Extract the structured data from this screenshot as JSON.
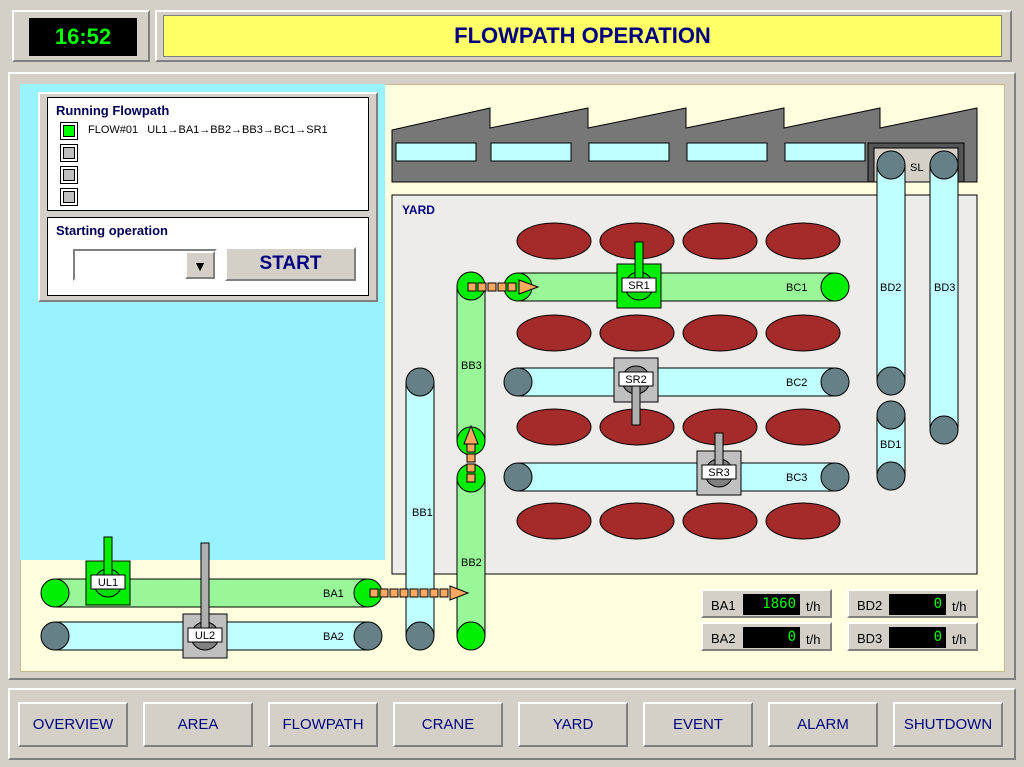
{
  "header": {
    "clock": "16:52",
    "title": "FLOWPATH OPERATION"
  },
  "running": {
    "title": "Running Flowpath",
    "flows": [
      {
        "label": "FLOW#01   UL1→BA1→BB2→BB3→BC1→SR1",
        "active": true
      },
      {
        "label": "",
        "active": false
      },
      {
        "label": "",
        "active": false
      },
      {
        "label": "",
        "active": false
      }
    ]
  },
  "starting": {
    "title": "Starting operation",
    "select_value": "",
    "start_label": "START"
  },
  "plant": {
    "yard_label": "YARD",
    "sl_label": "SL",
    "conveyors": {
      "BA1": "BA1",
      "BA2": "BA2",
      "BB1": "BB1",
      "BB2": "BB2",
      "BB3": "BB3",
      "BC1": "BC1",
      "BC2": "BC2",
      "BC3": "BC3",
      "BD1": "BD1",
      "BD2": "BD2",
      "BD3": "BD3"
    },
    "cranes": {
      "UL1": "UL1",
      "UL2": "UL2",
      "SR1": "SR1",
      "SR2": "SR2",
      "SR3": "SR3"
    },
    "colors": {
      "running": "#99f799",
      "idle": "#c0ffff",
      "active_crane": "#00ee00",
      "idle_crane": "#c0c0c0",
      "pile": "#a52a2a",
      "flow_arrow": "#ffa860"
    }
  },
  "readouts": [
    {
      "label": "BA1",
      "value": "1860",
      "unit": "t/h"
    },
    {
      "label": "BA2",
      "value": "0",
      "unit": "t/h"
    },
    {
      "label": "BD2",
      "value": "0",
      "unit": "t/h"
    },
    {
      "label": "BD3",
      "value": "0",
      "unit": "t/h"
    }
  ],
  "nav": [
    "OVERVIEW",
    "AREA",
    "FLOWPATH",
    "CRANE",
    "YARD",
    "EVENT",
    "ALARM",
    "SHUTDOWN"
  ]
}
